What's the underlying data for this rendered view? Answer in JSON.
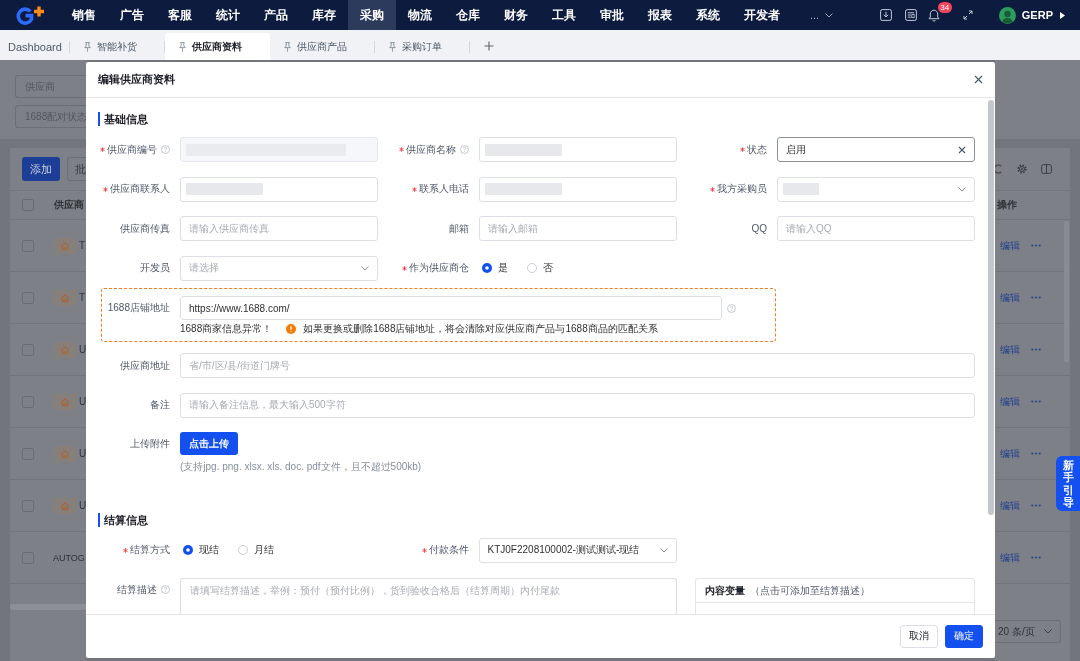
{
  "nav": {
    "menu": [
      {
        "label": "销售",
        "selected": false
      },
      {
        "label": "广告",
        "selected": false
      },
      {
        "label": "客服",
        "selected": false
      },
      {
        "label": "统计",
        "selected": false
      },
      {
        "label": "产品",
        "selected": false
      },
      {
        "label": "库存",
        "selected": false
      },
      {
        "label": "采购",
        "selected": true
      },
      {
        "label": "物流",
        "selected": false
      },
      {
        "label": "仓库",
        "selected": false
      },
      {
        "label": "财务",
        "selected": false
      },
      {
        "label": "工具",
        "selected": false
      },
      {
        "label": "审批",
        "selected": false
      },
      {
        "label": "报表",
        "selected": false
      },
      {
        "label": "系统",
        "selected": false
      },
      {
        "label": "开发者",
        "selected": false
      }
    ],
    "more": "...",
    "notifications": "34",
    "user": "GERP"
  },
  "tabs": [
    {
      "label": "Dashboard",
      "pinned": false,
      "selected": false
    },
    {
      "label": "智能补货",
      "pinned": true,
      "selected": false
    },
    {
      "label": "供应商资料",
      "pinned": true,
      "selected": true
    },
    {
      "label": "供应商产品",
      "pinned": true,
      "selected": false
    },
    {
      "label": "采购订单",
      "pinned": true,
      "selected": false
    }
  ],
  "page": {
    "filters": [
      {
        "placeholder": "供应商"
      },
      {
        "placeholder": "1688配对状态"
      }
    ],
    "buttons": [
      {
        "label": "添加",
        "primary": true
      },
      {
        "label": "批",
        "primary": false
      }
    ],
    "table": {
      "columns": [
        "供应商",
        "操作"
      ],
      "header_checked": false,
      "rows": [
        {
          "cell": "T",
          "tag_icon": true,
          "checked": false,
          "action": "编辑"
        },
        {
          "cell": "T",
          "tag_icon": true,
          "checked": false,
          "action": "编辑"
        },
        {
          "cell": "U",
          "tag_icon": true,
          "checked": false,
          "action": "编辑"
        },
        {
          "cell": "U",
          "tag_icon": true,
          "checked": false,
          "action": "编辑"
        },
        {
          "cell": "U",
          "tag_icon": true,
          "checked": false,
          "action": "编辑"
        },
        {
          "cell": "U",
          "tag_icon": true,
          "checked": false,
          "action": "编辑"
        },
        {
          "cell": "AUTOG",
          "tag_icon": false,
          "checked": false,
          "action": "编辑"
        }
      ]
    },
    "page_size": "20 条/页",
    "guide_button": "新手引导"
  },
  "dialog": {
    "title": "编辑供应商资料",
    "sections": [
      {
        "title": "基础信息",
        "rows": [
          [
            {
              "kind": "input",
              "label": "供应商编号",
              "required": true,
              "help": true,
              "disabled": true,
              "redacted": true
            },
            {
              "kind": "input",
              "label": "供应商名称",
              "required": true,
              "help": true,
              "disabled": false,
              "redacted": true
            },
            {
              "kind": "select",
              "label": "状态",
              "required": true,
              "value": "启用",
              "focused": true
            }
          ],
          [
            {
              "kind": "input",
              "label": "供应商联系人",
              "required": true,
              "redacted": true
            },
            {
              "kind": "input",
              "label": "联系人电话",
              "required": true,
              "redacted": true
            },
            {
              "kind": "select",
              "label": "我方采购员",
              "required": true,
              "redacted": true,
              "focused": false
            }
          ],
          [
            {
              "kind": "input",
              "label": "供应商传真",
              "required": false,
              "placeholder": "请输入供应商传真"
            },
            {
              "kind": "input",
              "label": "邮箱",
              "required": false,
              "placeholder": "请输入邮箱"
            },
            {
              "kind": "input",
              "label": "QQ",
              "required": false,
              "placeholder": "请输入QQ"
            }
          ],
          [
            {
              "kind": "select",
              "label": "开发员",
              "required": false,
              "placeholder": "请选择",
              "focused": false
            },
            {
              "kind": "radio",
              "label": "作为供应商仓",
              "required": true,
              "options": [
                {
                  "label": "是",
                  "selected": true
                },
                {
                  "label": "否",
                  "selected": false
                }
              ]
            }
          ],
          [
            {
              "kind": "store_url",
              "label": "1688店铺地址",
              "required": false,
              "help": true,
              "highlighted": true,
              "value": "https://www.1688.com/",
              "error": "1688商家信息异常！",
              "warning": "如果更换或删除1688店铺地址，将会清除对应供应商产品与1688商品的匹配关系"
            }
          ],
          [
            {
              "kind": "input",
              "label": "供应商地址",
              "required": false,
              "placeholder": "省/市/区/县/街道门牌号"
            }
          ],
          [
            {
              "kind": "input",
              "label": "备注",
              "required": false,
              "placeholder": "请输入备注信息，最大输入500字符"
            }
          ],
          [
            {
              "kind": "upload",
              "label": "上传附件",
              "required": false,
              "button": "点击上传",
              "hint": "(支持jpg. png. xlsx. xls. doc. pdf文件，且不超过500kb)"
            }
          ]
        ]
      },
      {
        "title": "结算信息",
        "rows": [
          [
            {
              "kind": "radio",
              "label": "结算方式",
              "required": true,
              "options": [
                {
                  "label": "现结",
                  "selected": true
                },
                {
                  "label": "月结",
                  "selected": false
                }
              ]
            },
            {
              "kind": "select",
              "label": "付款条件",
              "required": true,
              "value": "KTJ0F2208100002-测试测试-现结",
              "focused": false
            }
          ],
          [
            {
              "kind": "textarea",
              "label": "结算描述",
              "required": false,
              "help": true,
              "placeholder": "请填写结算描述，举例：预付（预付比例），货到验收合格后（结算周期）内付尾款"
            }
          ]
        ],
        "variables": {
          "title": "内容变量",
          "hint": "（点击可添加至结算描述）"
        }
      }
    ],
    "buttons": [
      {
        "label": "取消",
        "primary": false
      },
      {
        "label": "确定",
        "primary": true
      }
    ]
  }
}
